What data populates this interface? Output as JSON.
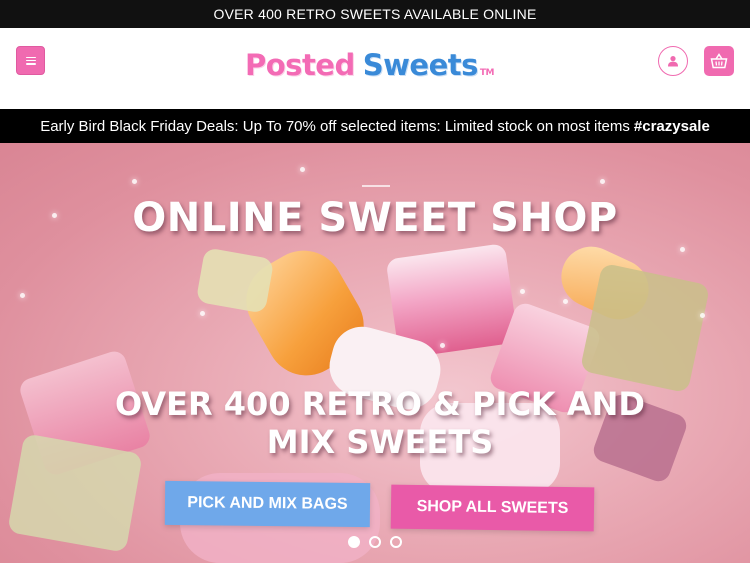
{
  "topbar": {
    "text": "OVER 400 RETRO SWEETS AVAILABLE ONLINE"
  },
  "header": {
    "logo_word1": "Posted",
    "logo_word2": "Sweets",
    "logo_tm": "TM",
    "menu_icon": "hamburger-icon",
    "account_icon": "user-icon",
    "cart_icon": "basket-icon"
  },
  "promo": {
    "text": "Early Bird Black Friday Deals: Up To 70% off selected items: Limited stock on most items",
    "hashtag": "#crazysale"
  },
  "hero": {
    "title": "ONLINE SWEET SHOP",
    "subtitle": "OVER 400 RETRO & PICK AND MIX SWEETS",
    "button_primary": "PICK AND MIX BAGS",
    "button_secondary": "SHOP ALL SWEETS",
    "slides_count": 3,
    "active_slide": 1
  },
  "colors": {
    "brand_pink": "#f06ab0",
    "brand_blue": "#3a8ad8",
    "button_blue": "#6fa8ea",
    "button_pink": "#e95aa8"
  }
}
